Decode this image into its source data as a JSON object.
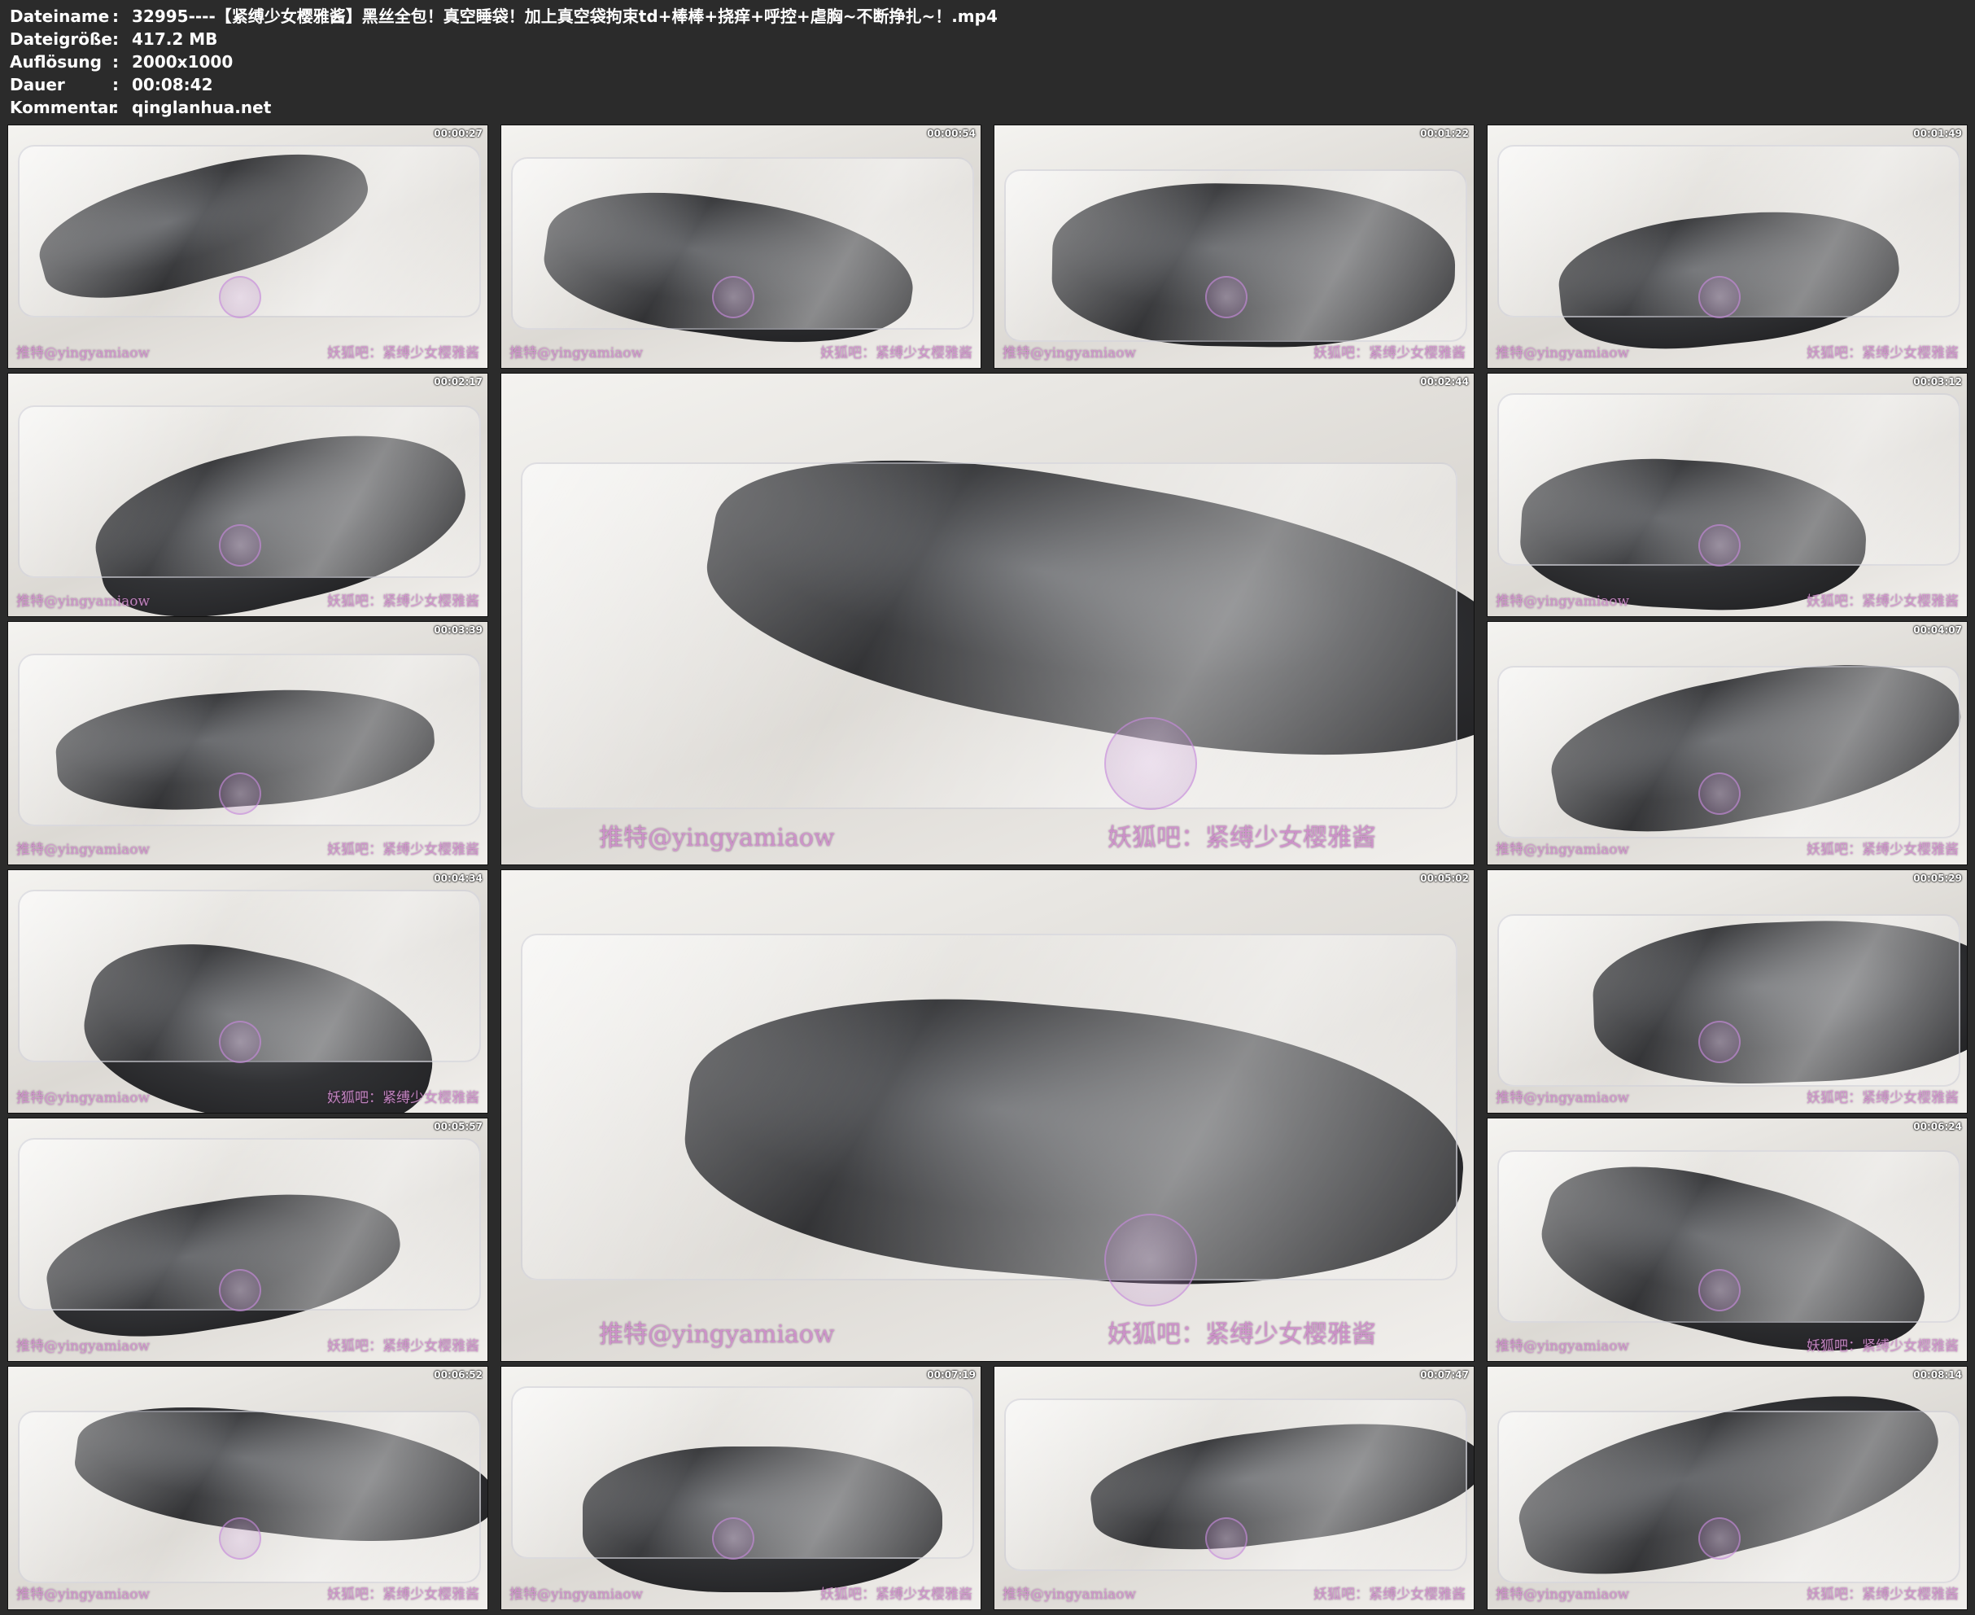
{
  "meta": [
    {
      "label": "Dateiname",
      "value": "32995----【紧缚少女樱雅酱】黑丝全包！真空睡袋！加上真空袋拘束td+棒棒+挠痒+呼控+虐胸~不断挣扎~！.mp4"
    },
    {
      "label": "Dateigröße",
      "value": "417.2 MB"
    },
    {
      "label": "Auflösung",
      "value": "2000x1000"
    },
    {
      "label": "Dauer",
      "value": "00:08:42"
    },
    {
      "label": "Kommentar",
      "value": "qinglanhua.net"
    }
  ],
  "separator": ":",
  "watermark": {
    "left": "推特@yingyamiaow",
    "right": "妖狐吧：紧缚少女樱雅酱"
  },
  "thumbnails": [
    {
      "timestamp": "00:00:27"
    },
    {
      "timestamp": "00:00:54"
    },
    {
      "timestamp": "00:01:22"
    },
    {
      "timestamp": "00:01:49"
    },
    {
      "timestamp": "00:02:17"
    },
    {
      "timestamp": "00:02:44"
    },
    {
      "timestamp": "00:03:12"
    },
    {
      "timestamp": "00:03:39"
    },
    {
      "timestamp": "00:04:07"
    },
    {
      "timestamp": "00:04:34"
    },
    {
      "timestamp": "00:05:02"
    },
    {
      "timestamp": "00:05:29"
    },
    {
      "timestamp": "00:05:57"
    },
    {
      "timestamp": "00:06:24"
    },
    {
      "timestamp": "00:06:52"
    },
    {
      "timestamp": "00:07:19"
    },
    {
      "timestamp": "00:07:47"
    },
    {
      "timestamp": "00:08:14"
    }
  ]
}
